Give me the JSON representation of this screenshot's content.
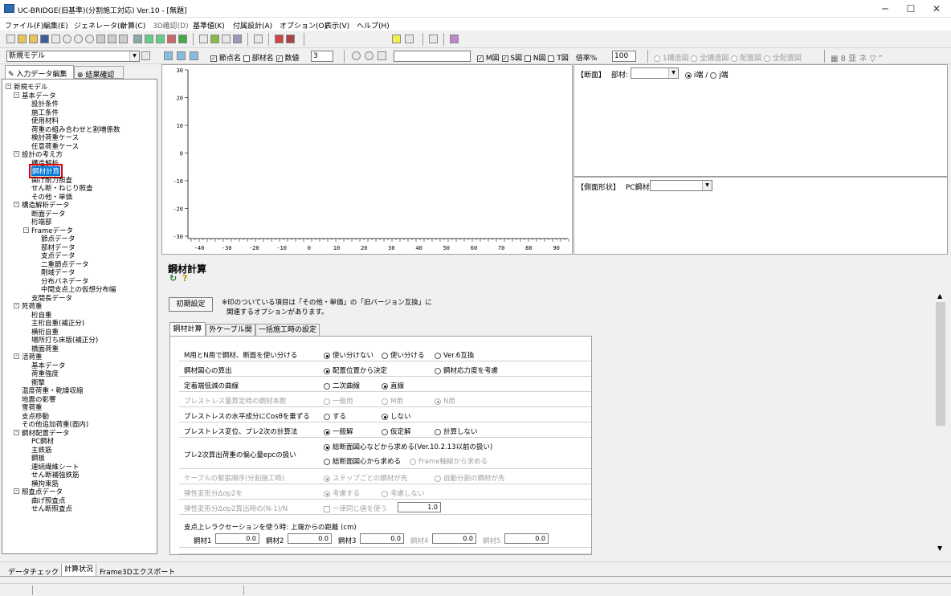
{
  "window": {
    "title": "UC-BRIDGE(旧基準)(分割施工対応) Ver.10 - [無題]",
    "minimize": "─",
    "maximize": "☐",
    "close": "✕"
  },
  "menu": [
    "ファイル(F)",
    "編集(E)",
    "ジェネレータ(I)",
    "計算(C)",
    "3D確認(D)",
    "基準値(K)",
    "付属設計(A)",
    "オプション(O)",
    "表示(V)",
    "ヘルプ(H)"
  ],
  "toolbar2": {
    "model_combo": "新規モデル",
    "node_name_label": "節点名",
    "member_name_label": "部材名",
    "value_label": "数値",
    "value_spin": "3",
    "m_label": "M図",
    "s_label": "S図",
    "n_label": "N図",
    "t_label": "T図",
    "scale_label": "倍率%",
    "scale_value": "100",
    "view_options": [
      "1構造図",
      "全構造図",
      "配置図",
      "全配置図"
    ],
    "right_icons": [
      "8",
      "亚",
      "ネ",
      "▽",
      "‴"
    ]
  },
  "left_tabs": {
    "input": "入力データ編集",
    "result": "結果確認"
  },
  "tree": [
    {
      "label": "新規モデル",
      "level": 0,
      "exp": "-"
    },
    {
      "label": "基本データ",
      "level": 1,
      "exp": "-"
    },
    {
      "label": "設計条件",
      "level": 2
    },
    {
      "label": "施工条件",
      "level": 2
    },
    {
      "label": "使用材料",
      "level": 2
    },
    {
      "label": "荷重の組み合わせと割増係数",
      "level": 2
    },
    {
      "label": "検討荷重ケース",
      "level": 2
    },
    {
      "label": "任意荷重ケース",
      "level": 2
    },
    {
      "label": "設計の考え方",
      "level": 1,
      "exp": "-"
    },
    {
      "label": "構造解析",
      "level": 2
    },
    {
      "label": "鋼材計算",
      "level": 2,
      "selected": true
    },
    {
      "label": "曲げ耐力照査",
      "level": 2
    },
    {
      "label": "せん断・ねじり照査",
      "level": 2
    },
    {
      "label": "その他・単価",
      "level": 2
    },
    {
      "label": "構造解析データ",
      "level": 1,
      "exp": "-"
    },
    {
      "label": "断面データ",
      "level": 2
    },
    {
      "label": "桁端部",
      "level": 2
    },
    {
      "label": "Frameデータ",
      "level": 2,
      "exp": "-"
    },
    {
      "label": "節点データ",
      "level": 3
    },
    {
      "label": "部材データ",
      "level": 3
    },
    {
      "label": "支点データ",
      "level": 3
    },
    {
      "label": "二重節点データ",
      "level": 3
    },
    {
      "label": "剛域データ",
      "level": 3
    },
    {
      "label": "分布バネデータ",
      "level": 3
    },
    {
      "label": "中間支点上の仮想分布幅",
      "level": 3
    },
    {
      "label": "支間長データ",
      "level": 2
    },
    {
      "label": "死荷重",
      "level": 1,
      "exp": "-"
    },
    {
      "label": "桁自重",
      "level": 2
    },
    {
      "label": "主桁自重(補正分)",
      "level": 2
    },
    {
      "label": "横桁自重",
      "level": 2
    },
    {
      "label": "場所打ち床版(補正分)",
      "level": 2
    },
    {
      "label": "橋面荷重",
      "level": 2
    },
    {
      "label": "活荷重",
      "level": 1,
      "exp": "-"
    },
    {
      "label": "基本データ",
      "level": 2
    },
    {
      "label": "荷重強度",
      "level": 2
    },
    {
      "label": "衝撃",
      "level": 2
    },
    {
      "label": "温度荷重・乾燥収縮",
      "level": 1
    },
    {
      "label": "地震の影響",
      "level": 1
    },
    {
      "label": "雪荷重",
      "level": 1
    },
    {
      "label": "支点移動",
      "level": 1
    },
    {
      "label": "その他追加荷重(面内)",
      "level": 1
    },
    {
      "label": "鋼材配置データ",
      "level": 1,
      "exp": "-"
    },
    {
      "label": "PC鋼材",
      "level": 2
    },
    {
      "label": "主鉄筋",
      "level": 2
    },
    {
      "label": "鋼板",
      "level": 2
    },
    {
      "label": "連続繊維シート",
      "level": 2
    },
    {
      "label": "せん断補強鉄筋",
      "level": 2
    },
    {
      "label": "横拘束筋",
      "level": 2
    },
    {
      "label": "照査点データ",
      "level": 1,
      "exp": "-"
    },
    {
      "label": "曲げ照査点",
      "level": 2
    },
    {
      "label": "せん断照査点",
      "level": 2
    }
  ],
  "chart": {
    "y_ticks": [
      "30",
      "20",
      "10",
      "0",
      "-10",
      "-20",
      "-30"
    ],
    "x_ticks": [
      "-40",
      "-30",
      "-20",
      "-10",
      "0",
      "10",
      "20",
      "30",
      "40",
      "50",
      "60",
      "70",
      "80",
      "90"
    ]
  },
  "section_panel": {
    "title": "【断面】",
    "member_label": "部材:",
    "end_i": "i端",
    "end_j": "j端",
    "sep": "/"
  },
  "side_panel": {
    "title": "【側面形状】",
    "pc_label": "PC鋼材:"
  },
  "form": {
    "title": "鋼材計算",
    "reset_button": "初期設定",
    "note_line1": "※印のついている項目は「その他・単価」の「旧バージョン互換」に",
    "note_line2": "関連するオプションがあります。",
    "tabs": [
      "鋼材計算",
      "外ケーブル関連",
      "一括施工時の設定"
    ],
    "rows": [
      {
        "label": "M用とN用で鋼材、断面を使い分ける",
        "options": [
          "使い分けない",
          "使い分ける",
          "Ver.6互換"
        ],
        "selected": 0,
        "disabled": false
      },
      {
        "label": "鋼材図心の算出",
        "options": [
          "配置位置から決定",
          "鋼材応力度を考慮"
        ],
        "selected": 0,
        "disabled": false
      },
      {
        "label": "定着端低減の曲線",
        "options": [
          "二次曲線",
          "直線"
        ],
        "selected": 1,
        "disabled": false
      },
      {
        "label": "プレストレス量算定時の鋼材本数",
        "options": [
          "一般用",
          "M用",
          "N用"
        ],
        "selected": 2,
        "disabled": true
      },
      {
        "label": "プレストレスの水平成分にCosθを乗ずる",
        "options": [
          "する",
          "しない"
        ],
        "selected": 1,
        "disabled": false
      },
      {
        "label": "プレストレス変位、プレ2次の計算法",
        "options": [
          "一般解",
          "仮定解",
          "計算しない"
        ],
        "selected": 0,
        "disabled": false
      },
      {
        "label": "プレ2次算出荷重の偏心量epcの扱い",
        "options": [
          "総断面図心などから求める(Ver.10.2.13以前の扱い)",
          "総断面図心から求める",
          "Frame軸線から求める"
        ],
        "selected": 0,
        "disabled": false
      },
      {
        "label": "ケーブルの緊張順序(分割施工時)",
        "options": [
          "ステップごとの鋼材が先",
          "自動分割の鋼材が先"
        ],
        "selected": 0,
        "disabled": true
      },
      {
        "label": "弾性変形分Δσp2を",
        "options": [
          "考慮する",
          "考慮しない"
        ],
        "selected": 0,
        "disabled": true
      },
      {
        "label": "弾性変形分Δσp2算出時の(N-1)/N",
        "check": "一律同じ値を使う",
        "value": "1.0",
        "disabled": true
      }
    ],
    "relax": {
      "title": "支点上レラクセーションを使う時: 上端からの距離 (cm)",
      "items": [
        {
          "label": "鋼材1",
          "value": "0.0"
        },
        {
          "label": "鋼材2",
          "value": "0.0"
        },
        {
          "label": "鋼材3",
          "value": "0.0"
        },
        {
          "label": "鋼材4",
          "value": "0.0"
        },
        {
          "label": "鋼材5",
          "value": "0.0"
        }
      ]
    }
  },
  "bottom_tabs": [
    "データチェック",
    "計算状況",
    "Frame3Dエクスポート"
  ]
}
